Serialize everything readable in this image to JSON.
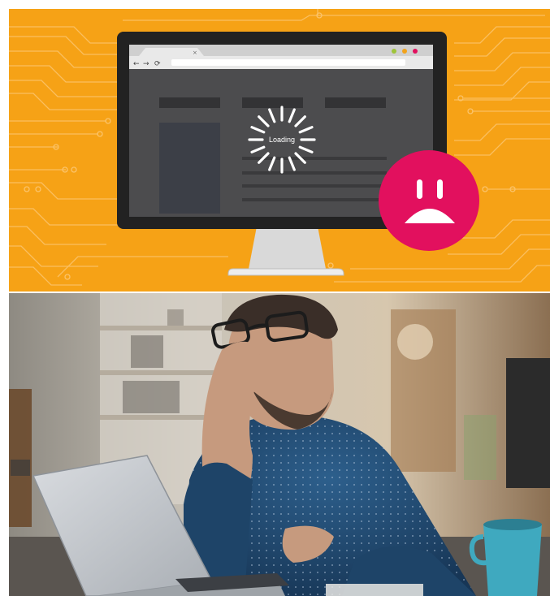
{
  "illustration": {
    "loading_label": "Loading",
    "tab_close_glyph": "×",
    "nav_back_glyph": "←",
    "nav_forward_glyph": "→",
    "nav_reload_glyph": "⟳",
    "icons": [
      "spinner-icon",
      "sad-face-icon",
      "circuit-pattern"
    ],
    "colors": {
      "background": "#F6A216",
      "circuit": "#FBC36A",
      "monitor_bezel": "#222222",
      "screen_bg": "#4C4C4E",
      "sad_face": "#E2105E",
      "window_red": "#E2105E",
      "window_yellow": "#F2A31B",
      "window_green": "#9FC43A"
    }
  },
  "photo": {
    "subject": "person-at-laptop"
  }
}
